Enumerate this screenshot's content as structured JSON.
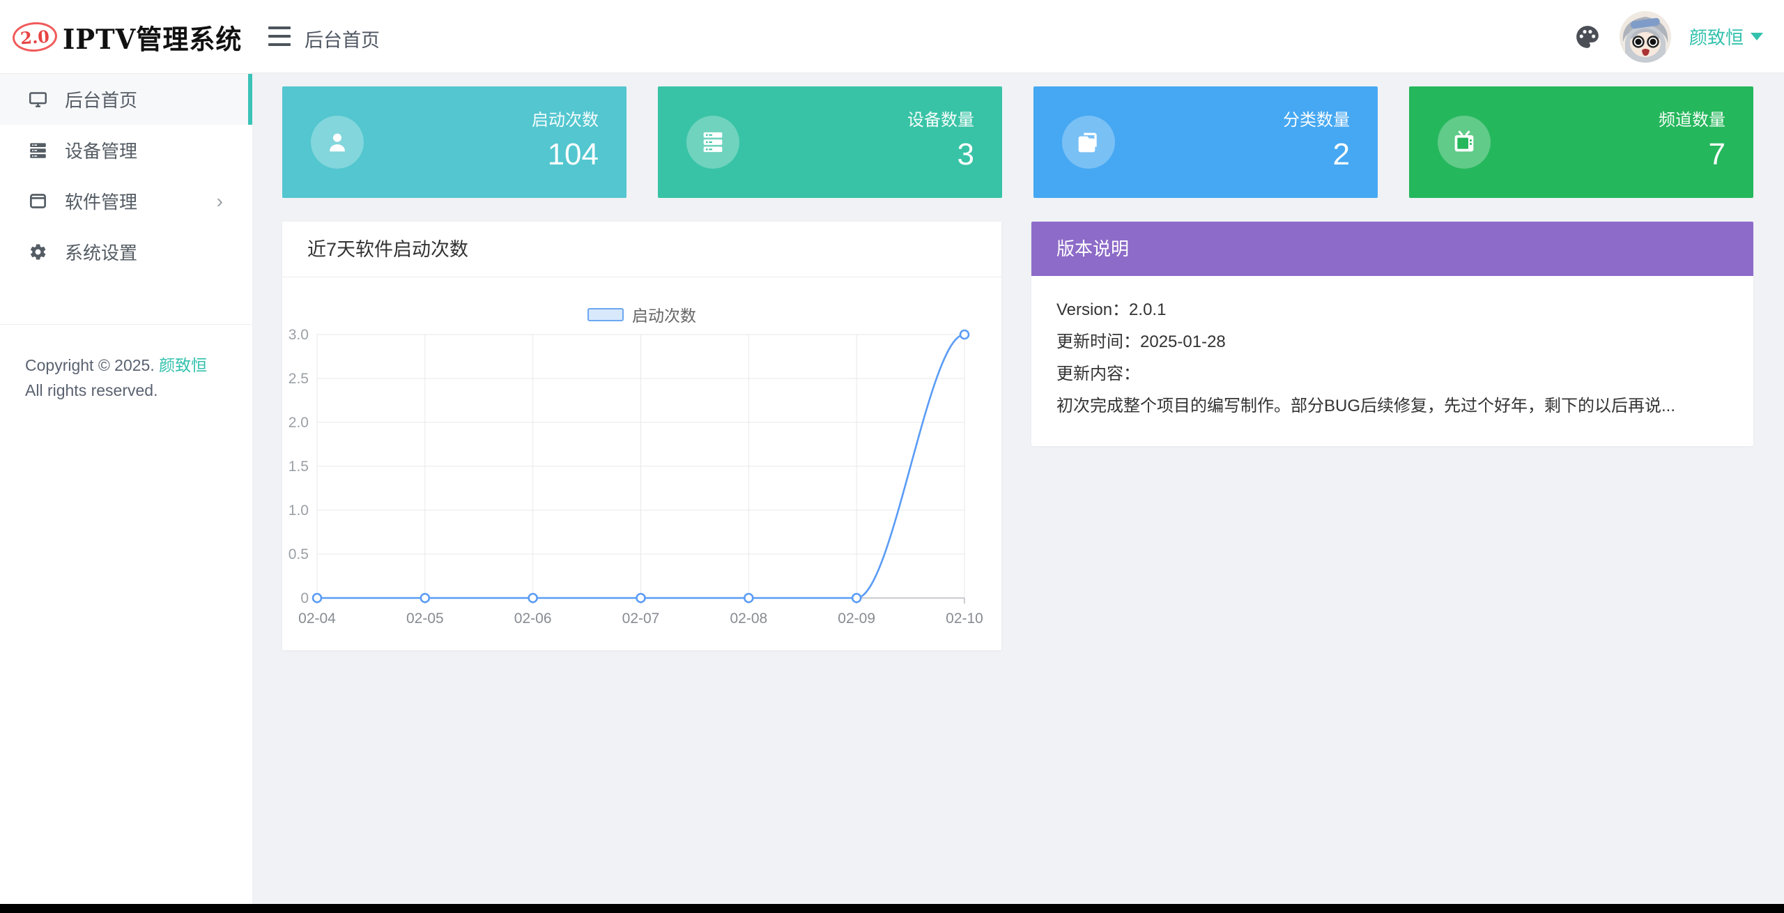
{
  "app": {
    "logo_badge": "2.0",
    "logo_title": "IPTV管理系统"
  },
  "header": {
    "breadcrumb": "后台首页",
    "username": "颜致恒",
    "icons": [
      "hamburger-icon",
      "palette-icon",
      "avatar",
      "caret-down-icon"
    ],
    "accent_color": "#32c1ad"
  },
  "sidebar": {
    "items": [
      {
        "label": "后台首页",
        "icon": "monitor-icon",
        "active": true
      },
      {
        "label": "设备管理",
        "icon": "server-icon",
        "active": false
      },
      {
        "label": "软件管理",
        "icon": "app-window-icon",
        "active": false,
        "has_children": true
      },
      {
        "label": "系统设置",
        "icon": "gear-icon",
        "active": false
      }
    ],
    "active_indicator_color": "#3bc3b8",
    "copyright_prefix": "Copyright © 2025.",
    "copyright_name": "颜致恒",
    "copyright_suffix": "All rights reserved."
  },
  "stats": [
    {
      "label": "启动次数",
      "value": "104",
      "color": "#53c6cf",
      "icon": "user-icon"
    },
    {
      "label": "设备数量",
      "value": "3",
      "color": "#38c3a6",
      "icon": "server-icon"
    },
    {
      "label": "分类数量",
      "value": "2",
      "color": "#46a8f2",
      "icon": "folder-icon"
    },
    {
      "label": "频道数量",
      "value": "7",
      "color": "#25b75c",
      "icon": "tv-icon"
    }
  ],
  "chart_card": {
    "title": "近7天软件启动次数"
  },
  "chart_data": {
    "type": "line",
    "title": "近7天软件启动次数",
    "categories": [
      "02-04",
      "02-05",
      "02-06",
      "02-07",
      "02-08",
      "02-09",
      "02-10"
    ],
    "series": [
      {
        "name": "启动次数",
        "values": [
          0,
          0,
          0,
          0,
          0,
          0,
          3
        ]
      }
    ],
    "xlabel": "",
    "ylabel": "",
    "ylim": [
      0,
      3
    ],
    "yticks": [
      0,
      0.5,
      1,
      1.5,
      2,
      2.5,
      3
    ],
    "ytick_labels": [
      "0",
      "0.5",
      "1.0",
      "1.5",
      "2.0",
      "2.5",
      "3.0"
    ],
    "grid": true,
    "smooth": true,
    "marker": "empty-circle",
    "legend_position": "top-center",
    "line_color": "#5a9cf5",
    "legend_fill": "#d8e9fc",
    "legend_border": "#6ba7f0",
    "gridline_color": "#e8e8e8",
    "axis_line_color": "#b8bcc2",
    "tick_text_color": "#9aa0a6"
  },
  "version_card": {
    "header": "版本说明",
    "header_color": "#8d6bc8",
    "rows": [
      "Version：2.0.1",
      "更新时间：2025-01-28",
      "更新内容：",
      "初次完成整个项目的编写制作。部分BUG后续修复，先过个好年，剩下的以后再说..."
    ]
  }
}
